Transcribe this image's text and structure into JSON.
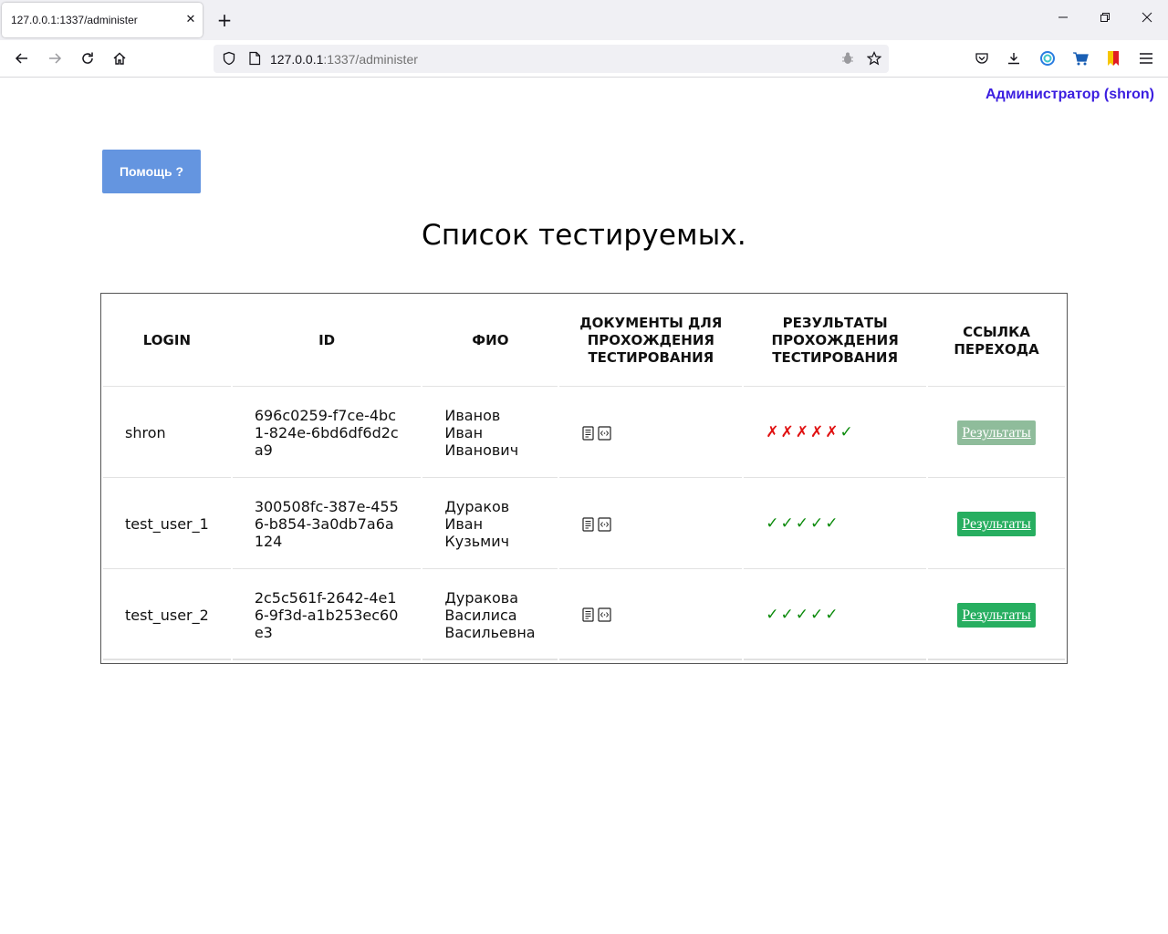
{
  "browser": {
    "tab_title": "127.0.0.1:1337/administer",
    "url_host": "127.0.0.1",
    "url_rest": ":1337/administer"
  },
  "page": {
    "user_label": "Администратор (shron)",
    "help_button": "Помощь ?",
    "title": "Список тестируемых."
  },
  "table": {
    "headers": [
      "LOGIN",
      "ID",
      "ФИО",
      "ДОКУМЕНТЫ ДЛЯ ПРОХОЖДЕНИЯ ТЕСТИРОВАНИЯ",
      "РЕЗУЛЬТАТЫ ПРОХОЖДЕНИЯ ТЕСТИРОВАНИЯ",
      "ССЫЛКА ПЕРЕХОДА"
    ],
    "rows": [
      {
        "login": "shron",
        "id": "696c0259-f7ce-4bc1-824e-6bd6df6d2ca9",
        "fio_last": "Иванов",
        "fio_first": "Иван",
        "fio_middle": "Иванович",
        "results": [
          "✗",
          "✗",
          "✗",
          "✗",
          "✗",
          "✓"
        ],
        "link_label": "Результаты",
        "link_color": "#8fbc9b"
      },
      {
        "login": "test_user_1",
        "id": "300508fc-387e-4556-b854-3a0db7a6a124",
        "fio_last": "Дураков",
        "fio_first": "Иван",
        "fio_middle": "Кузьмич",
        "results": [
          "✓",
          "✓",
          "✓",
          "✓",
          "✓"
        ],
        "link_label": "Результаты",
        "link_color": "#27ae60"
      },
      {
        "login": "test_user_2",
        "id": "2c5c561f-2642-4e16-9f3d-a1b253ec60e3",
        "fio_last": "Дуракова",
        "fio_first": "Василиса",
        "fio_middle": "Васильевна",
        "results": [
          "✓",
          "✓",
          "✓",
          "✓",
          "✓"
        ],
        "link_label": "Результаты",
        "link_color": "#27ae60"
      }
    ]
  },
  "colors": {
    "help_button_bg": "#6495e0",
    "user_label": "#3b1ee0",
    "mark_fail": "#e01010",
    "mark_pass": "#0a8a0a"
  }
}
